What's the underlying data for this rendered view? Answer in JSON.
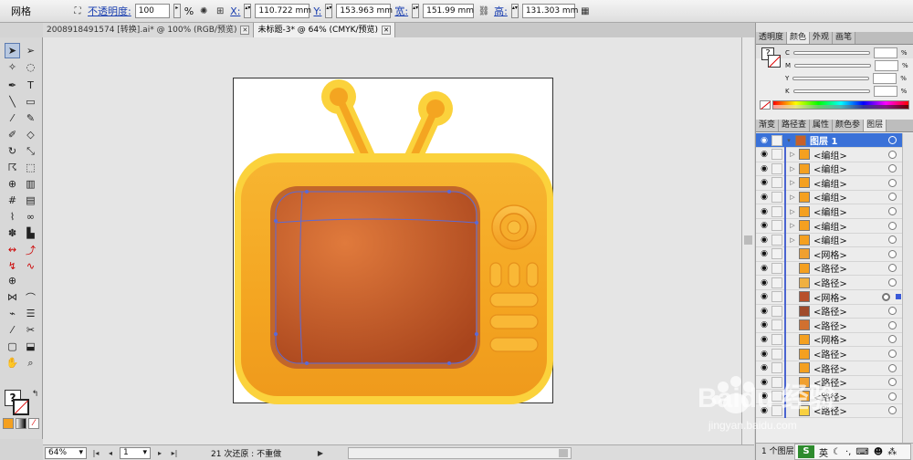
{
  "control_bar": {
    "mode": "网格",
    "opacity_label": "不透明度:",
    "opacity_value": "100",
    "opacity_unit": "%",
    "x_label": "X:",
    "x_value": "110.722 mm",
    "y_label": "Y:",
    "y_value": "153.963 mm",
    "width_label": "宽:",
    "width_value": "151.99 mm",
    "height_label": "高:",
    "height_value": "131.303 mm"
  },
  "tabs": [
    {
      "label": "2008918491574  [转换].ai* @ 100% (RGB/预览)",
      "active": false
    },
    {
      "label": "未标题-3* @ 64% (CMYK/预览)",
      "active": true
    }
  ],
  "status_bar": {
    "zoom": "64%",
    "page": "1",
    "history": "21 次还原 : 不重做"
  },
  "color_panel": {
    "tabs": [
      "透明度",
      "颜色",
      "外观",
      "画笔"
    ],
    "active_tab": "颜色",
    "channels": [
      {
        "label": "C",
        "value": "",
        "unit": "%"
      },
      {
        "label": "M",
        "value": "",
        "unit": "%"
      },
      {
        "label": "Y",
        "value": "",
        "unit": "%"
      },
      {
        "label": "K",
        "value": "",
        "unit": "%"
      }
    ]
  },
  "layers_panel": {
    "tabs": [
      "渐变",
      "路径查",
      "属性",
      "颜色参",
      "图层"
    ],
    "active_tab": "图层",
    "top_layer": "图层 1",
    "rows": [
      {
        "name": "<编组>",
        "expand": true,
        "thumb": "#f4a020"
      },
      {
        "name": "<编组>",
        "expand": true,
        "thumb": "#f4a020"
      },
      {
        "name": "<编组>",
        "expand": true,
        "thumb": "#f4a020"
      },
      {
        "name": "<编组>",
        "expand": true,
        "thumb": "#f4a020"
      },
      {
        "name": "<编组>",
        "expand": true,
        "thumb": "#f4a020"
      },
      {
        "name": "<编组>",
        "expand": true,
        "thumb": "#f4a020"
      },
      {
        "name": "<编组>",
        "expand": true,
        "thumb": "#f4a020"
      },
      {
        "name": "<网格>",
        "expand": false,
        "thumb": "#f0a030"
      },
      {
        "name": "<路径>",
        "expand": false,
        "thumb": "#f4a020"
      },
      {
        "name": "<路径>",
        "expand": false,
        "thumb": "#f0b040"
      },
      {
        "name": "<网格>",
        "expand": false,
        "thumb": "#b8502a",
        "selected": true
      },
      {
        "name": "<路径>",
        "expand": false,
        "thumb": "#a04a2a"
      },
      {
        "name": "<路径>",
        "expand": false,
        "thumb": "#d07030"
      },
      {
        "name": "<网格>",
        "expand": false,
        "thumb": "#f4a020"
      },
      {
        "name": "<路径>",
        "expand": false,
        "thumb": "#f4a020"
      },
      {
        "name": "<路径>",
        "expand": false,
        "thumb": "#f4a020"
      },
      {
        "name": "<路径>",
        "expand": false,
        "thumb": "#f0a030"
      },
      {
        "name": "<路径>",
        "expand": false,
        "thumb": "#f4a020"
      },
      {
        "name": "<路径>",
        "expand": false,
        "thumb": "#f8d040"
      }
    ],
    "footer": "1 个图层"
  },
  "ime": {
    "logo": "S",
    "lang": "英"
  },
  "watermark": {
    "brand": "Baidu 经验",
    "url": "jingyan.baidu.com"
  },
  "colors": {
    "tv_outer": "#fbd23c",
    "tv_body": "#f4a521",
    "screen_light": "#e07a3c",
    "screen_dark": "#a8441c",
    "selection": "#5a6ad8"
  }
}
